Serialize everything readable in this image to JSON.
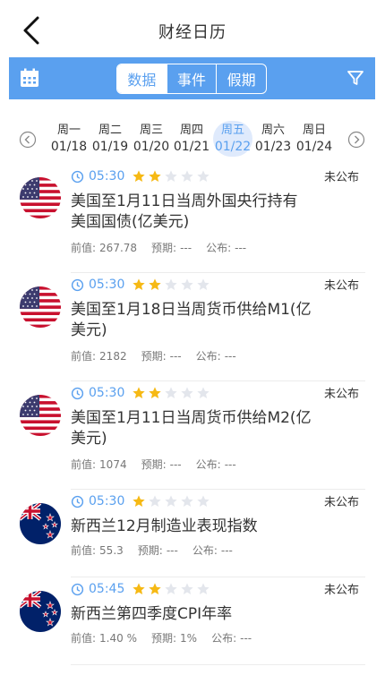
{
  "header": {
    "title": "财经日历",
    "back_icon": "back-arrow-icon"
  },
  "toolbar": {
    "accent": "#5aa0ef",
    "calendar_icon": "calendar-icon",
    "filter_icon": "filter-icon",
    "tabs": [
      {
        "label": "数据",
        "active": true
      },
      {
        "label": "事件",
        "active": false
      },
      {
        "label": "假期",
        "active": false
      }
    ]
  },
  "week": {
    "days": [
      {
        "weekday": "周一",
        "date": "01/18",
        "active": false
      },
      {
        "weekday": "周二",
        "date": "01/19",
        "active": false
      },
      {
        "weekday": "周三",
        "date": "01/20",
        "active": false
      },
      {
        "weekday": "周四",
        "date": "01/21",
        "active": false
      },
      {
        "weekday": "周五",
        "date": "01/22",
        "active": true
      },
      {
        "weekday": "周六",
        "date": "01/23",
        "active": false
      },
      {
        "weekday": "周日",
        "date": "01/24",
        "active": false
      }
    ]
  },
  "labels": {
    "prev": "前值:",
    "forecast": "预期:",
    "publish": "公布:"
  },
  "events": [
    {
      "flag": "us-flag-icon",
      "time": "05:30",
      "stars": 2,
      "status": "未公布",
      "title": "美国至1月11日当周外国央行持有美国国债(亿美元)",
      "prev": "267.78",
      "forecast": "---",
      "actual": "---"
    },
    {
      "flag": "us-flag-icon",
      "time": "05:30",
      "stars": 2,
      "status": "未公布",
      "title": "美国至1月18日当周货币供给M1(亿美元)",
      "prev": "2182",
      "forecast": "---",
      "actual": "---"
    },
    {
      "flag": "us-flag-icon",
      "time": "05:30",
      "stars": 2,
      "status": "未公布",
      "title": "美国至1月11日当周货币供给M2(亿美元)",
      "prev": "1074",
      "forecast": "---",
      "actual": "---"
    },
    {
      "flag": "nz-flag-icon",
      "time": "05:30",
      "stars": 1,
      "status": "未公布",
      "title": "新西兰12月制造业表现指数",
      "prev": "55.3",
      "forecast": "---",
      "actual": "---"
    },
    {
      "flag": "nz-flag-icon",
      "time": "05:45",
      "stars": 2,
      "status": "未公布",
      "title": "新西兰第四季度CPI年率",
      "prev": "1.40 %",
      "forecast": "1%",
      "actual": "---"
    }
  ]
}
